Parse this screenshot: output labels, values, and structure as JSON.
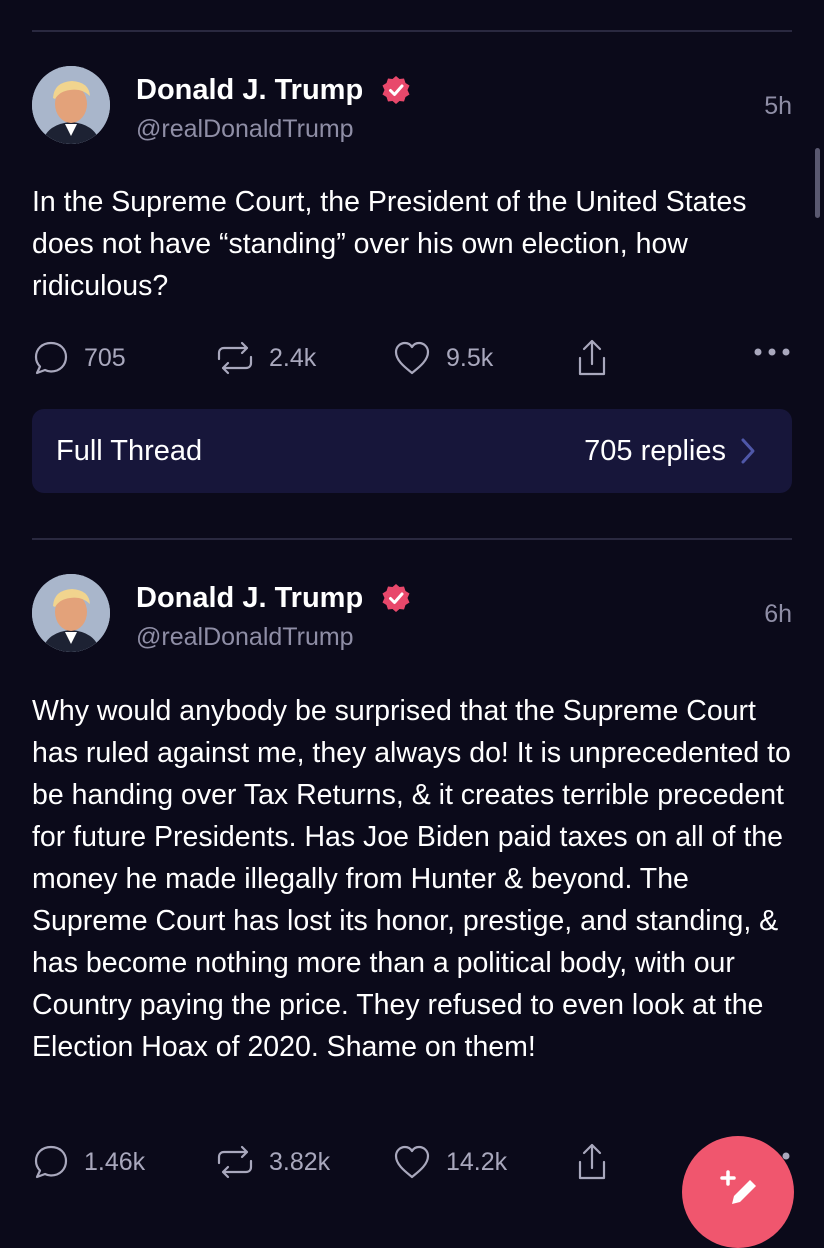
{
  "colors": {
    "background": "#0b0a1a",
    "verified_badge": "#e8486b",
    "fab": "#f0566e",
    "thread_bar": "#17163a"
  },
  "posts": [
    {
      "author": "Donald J. Trump",
      "handle": "@realDonaldTrump",
      "time": "5h",
      "text": "In the Supreme Court, the President of the United States does not have “standing” over his own election, how ridiculous?",
      "stats": {
        "replies": "705",
        "reposts": "2.4k",
        "likes": "9.5k"
      }
    },
    {
      "author": "Donald J. Trump",
      "handle": "@realDonaldTrump",
      "time": "6h",
      "text": "Why would anybody be surprised that the Supreme Court has ruled against me, they always do! It is unprecedented to be handing over Tax Returns, & it creates terrible precedent for future Presidents. Has Joe Biden paid taxes on all of the money he made illegally from Hunter & beyond. The Supreme Court has lost its honor, prestige, and standing, & has become nothing more than a political body, with our Country paying the price. They refused to even look at the Election Hoax of 2020. Shame on them!",
      "stats": {
        "replies": "1.46k",
        "reposts": "3.82k",
        "likes": "14.2k"
      }
    }
  ],
  "thread": {
    "label": "Full Thread",
    "replies": "705 replies"
  },
  "icons": [
    "reply-icon",
    "repost-icon",
    "like-icon",
    "share-icon",
    "more-icon",
    "verified-icon",
    "chevron-right-icon",
    "compose-icon"
  ]
}
